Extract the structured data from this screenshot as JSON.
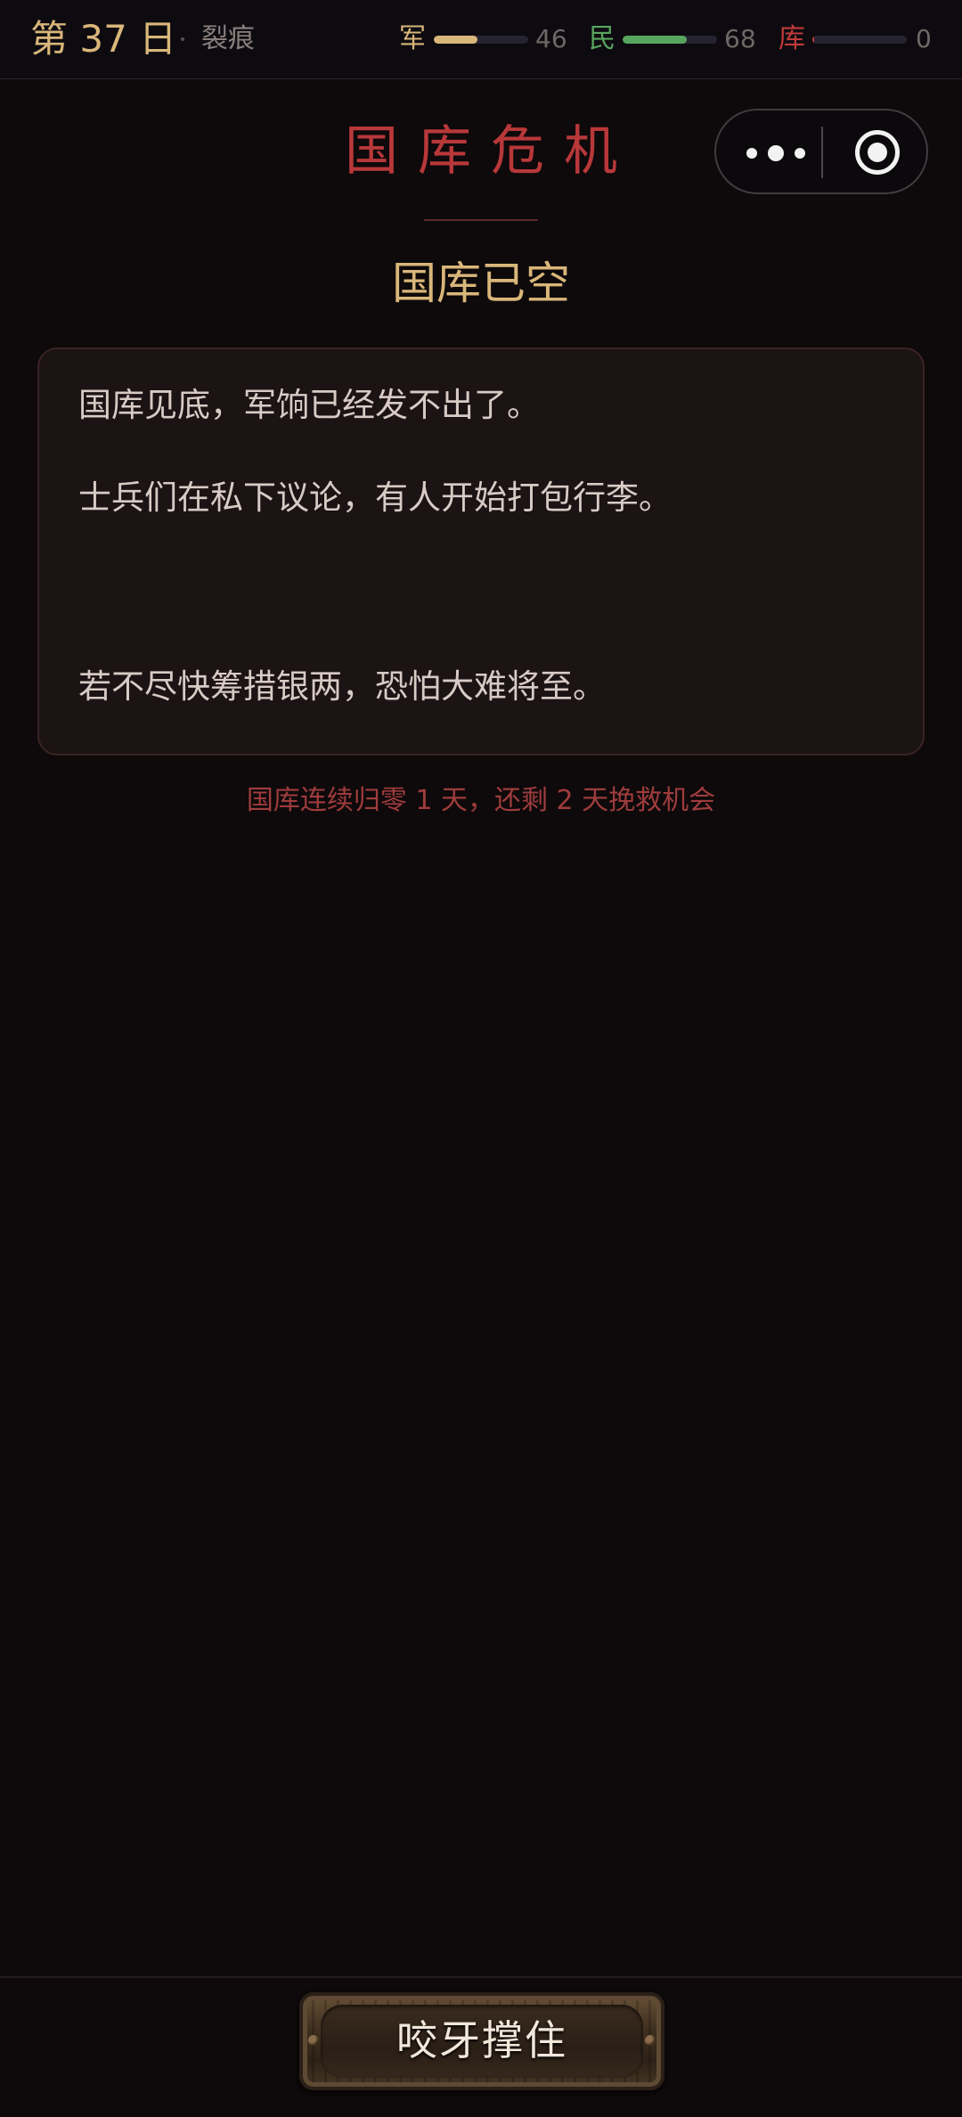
{
  "status": {
    "day": "第 37 日",
    "phase": "裂痕",
    "stats": [
      {
        "label": "军",
        "value": "46",
        "level": 0.46,
        "color": "#d9b67a"
      },
      {
        "label": "民",
        "value": "68",
        "level": 0.68,
        "color": "#58a55e"
      },
      {
        "label": "库",
        "value": "0",
        "level": 0.0,
        "color": "#c23a3a"
      }
    ]
  },
  "capsule": {
    "more_icon": "more-icon",
    "close_icon": "target-icon"
  },
  "event": {
    "title": "国库危机",
    "subtitle": "国库已空",
    "paragraphs": [
      "国库见底，军饷已经发不出了。",
      "士兵们在私下议论，有人开始打包行李。",
      "若不尽快筹措银两，恐怕大难将至。"
    ],
    "notice": "国库连续归零 1 天，还剩 2 天挽救机会"
  },
  "action": {
    "label": "咬牙撑住"
  },
  "colors": {
    "accent_gold": "#d9b67a",
    "danger_red": "#b8383a",
    "background": "#0e090a"
  }
}
